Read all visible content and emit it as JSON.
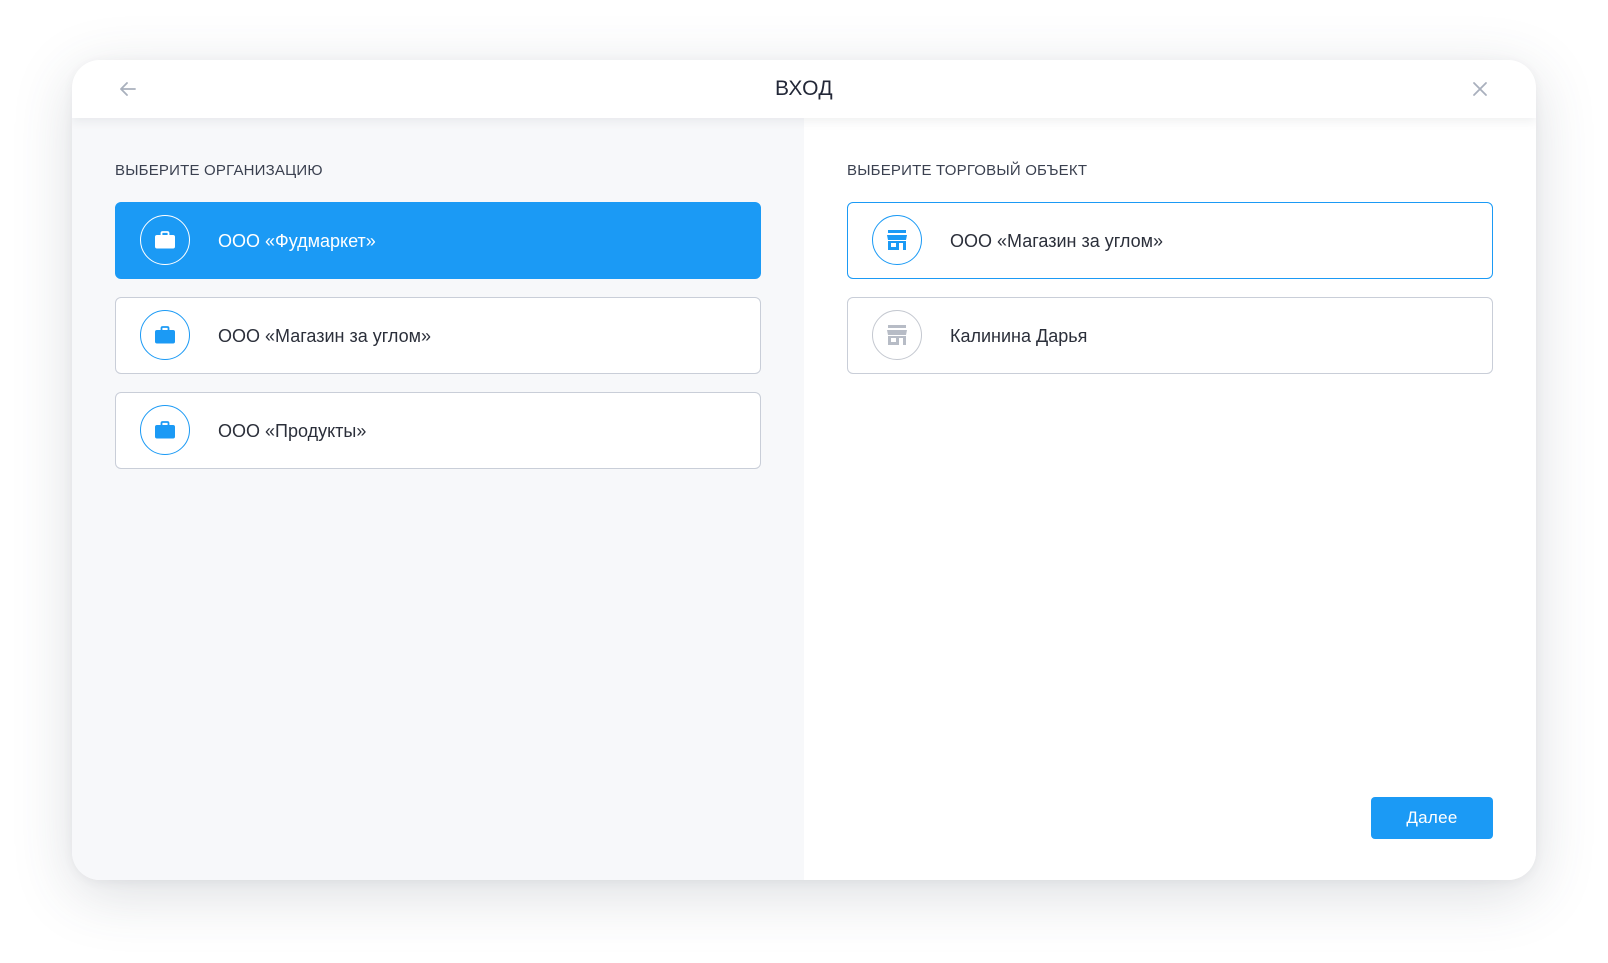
{
  "header": {
    "title": "ВХОД",
    "back_icon": "arrow-left-icon",
    "close_icon": "close-icon"
  },
  "organizations": {
    "heading": "ВЫБЕРИТЕ ОРГАНИЗАЦИЮ",
    "icon": "briefcase-icon",
    "items": [
      {
        "label": "ООО «Фудмаркет»",
        "selected": true
      },
      {
        "label": "ООО «Магазин за углом»",
        "selected": false
      },
      {
        "label": "ООО «Продукты»",
        "selected": false
      }
    ]
  },
  "stores": {
    "heading": "ВЫБЕРИТЕ ТОРГОВЫЙ ОБЪЕКТ",
    "icon": "store-icon",
    "items": [
      {
        "label": "ООО «Магазин за углом»",
        "active": true
      },
      {
        "label": "Калинина Дарья",
        "active": false
      }
    ]
  },
  "footer": {
    "next_label": "Далее"
  },
  "colors": {
    "accent": "#1b9af5",
    "muted_icon": "#c4c8d0",
    "left_panel_bg": "#f7f8fa"
  }
}
